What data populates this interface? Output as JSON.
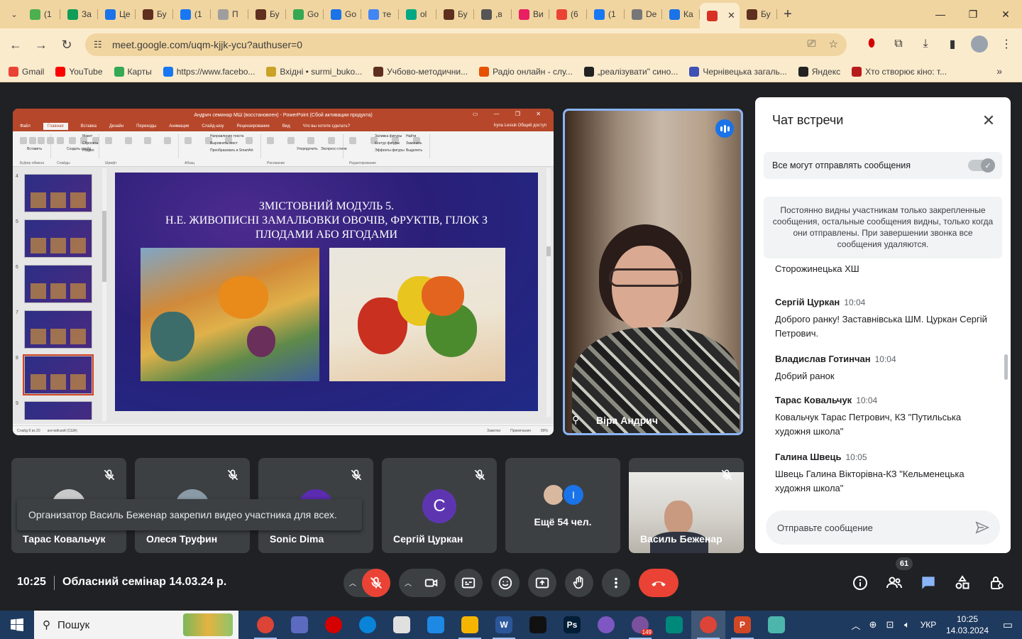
{
  "browser": {
    "tabs": [
      {
        "label": "(1",
        "color": "#4caf50"
      },
      {
        "label": "За",
        "color": "#0f9d58"
      },
      {
        "label": "Це",
        "color": "#1a73e8"
      },
      {
        "label": "Бу",
        "color": "#5f2f1f"
      },
      {
        "label": "(1",
        "color": "#1877f2"
      },
      {
        "label": "П",
        "color": "#9e9e9e"
      },
      {
        "label": "Бу",
        "color": "#5f2f1f"
      },
      {
        "label": "Go",
        "color": "#34a853"
      },
      {
        "label": "Go",
        "color": "#1a73e8"
      },
      {
        "label": "те",
        "color": "#4285f4"
      },
      {
        "label": "ol",
        "color": "#00a884"
      },
      {
        "label": "Бу",
        "color": "#5f2f1f"
      },
      {
        "label": ",в",
        "color": "#555555"
      },
      {
        "label": "Ви",
        "color": "#e91e63"
      },
      {
        "label": "(6",
        "color": "#ea4335"
      },
      {
        "label": "(1",
        "color": "#1877f2"
      },
      {
        "label": "De",
        "color": "#777777"
      },
      {
        "label": "Ка",
        "color": "#1a73e8"
      },
      {
        "label": "",
        "color": "#d93025"
      },
      {
        "label": "Бу",
        "color": "#5f2f1f"
      }
    ],
    "active_tab_index": 18,
    "url": "meet.google.com/uqm-kjjk-ycu?authuser=0",
    "bookmarks": [
      {
        "label": "Gmail",
        "color": "#ea4335"
      },
      {
        "label": "YouTube",
        "color": "#ff0000"
      },
      {
        "label": "Карты",
        "color": "#34a853"
      },
      {
        "label": "https://www.facebo...",
        "color": "#1877f2"
      },
      {
        "label": "Вхідні • surmi_buko...",
        "color": "#c9a227"
      },
      {
        "label": "Учбово-методични...",
        "color": "#5f2f1f"
      },
      {
        "label": "Радіо онлайн - слу...",
        "color": "#e65100"
      },
      {
        "label": "„реалізувати\" сино...",
        "color": "#222222"
      },
      {
        "label": "Чернівецька загаль...",
        "color": "#3f51b5"
      },
      {
        "label": "Яндекс",
        "color": "#222222"
      },
      {
        "label": "Хто створює кіно: т...",
        "color": "#b71c1c"
      }
    ]
  },
  "presentation": {
    "window_title": "Андрич семинар МШ (восстановлен) - PowerPoint (Сбой активации продукта)",
    "menu": [
      "Файл",
      "Главная",
      "Вставка",
      "Дизайн",
      "Переходы",
      "Анимация",
      "Слайд-шоу",
      "Рецензирование",
      "Вид",
      "Что вы хотите сделать?"
    ],
    "user": "Iryna Lesiuk   Общий доступ",
    "ribbon_groups": [
      "Буфер обмена",
      "Слайды",
      "Шрифт",
      "Абзац",
      "Рисование",
      "Редактирование"
    ],
    "ribbon_items": [
      "Вставить",
      "Создать слайд",
      "Макет",
      "Сбросить",
      "Раздел",
      "Направление текста",
      "Выровнять текст",
      "Преобразовать в SmartArt",
      "Упорядочить",
      "Экспресс-стили",
      "Заливка фигуры",
      "Контур фигуры",
      "Эффекты фигуры",
      "Найти",
      "Заменить",
      "Выделить"
    ],
    "thumbnail_numbers": [
      "4",
      "5",
      "6",
      "7",
      "8",
      "9"
    ],
    "selected_thumbnail": "8",
    "slide_title_lines": [
      "ЗМІСТОВНИЙ МОДУЛЬ 5.",
      "Н.Е. ЖИВОПИСНІ ЗАМАЛЬОВКИ ОВОЧІВ, ФРУКТІВ, ГІЛОК З",
      "ПЛОДАМИ АБО ЯГОДАМИ"
    ],
    "status_left": "Слайд 8 из 20",
    "status_lang": "английский (США)",
    "status_notes": "Заметки",
    "status_comments": "Примечания",
    "zoom": "89%"
  },
  "speaker": {
    "name": "Віра Андрич"
  },
  "participants": [
    {
      "name": "Тарас Ковальчук",
      "avatar_color": "#c9c9c9",
      "initial": ""
    },
    {
      "name": "Олеся Труфин",
      "avatar_color": "#8a9aa6",
      "initial": ""
    },
    {
      "name": "Sonic Dima",
      "avatar_color": "#5b2bb0",
      "initial": ""
    },
    {
      "name": "Сергій Цуркан",
      "avatar_color": "#5e35b1",
      "initial": "С"
    }
  ],
  "more_tile": {
    "label": "Ещё 54 чел.",
    "avatar_initial": "I",
    "avatar_color": "#1a73e8"
  },
  "video_participant": {
    "name": "Василь Беженар"
  },
  "toast": "Организатор Василь Беженар закрепил видео участника для всех.",
  "chat": {
    "title": "Чат встречи",
    "toggle_label": "Все могут отправлять сообщения",
    "notice": "Постоянно видны участникам только закрепленные сообщения, остальные сообщения видны, только когда они отправлены. При завершении звонка все сообщения удаляются.",
    "cut_message": "Сторожинецька ХШ",
    "messages": [
      {
        "author": "Сергій Цуркан",
        "time": "10:04",
        "text": "Доброго ранку! Заставнівська ШМ. Цуркан Сергій Петрович."
      },
      {
        "author": "Владислав Готинчан",
        "time": "10:04",
        "text": "Добрий ранок"
      },
      {
        "author": "Тарас Ковальчук",
        "time": "10:04",
        "text": "Ковальчук Тарас Петрович, КЗ \"Путильська художня школа\""
      },
      {
        "author": "Галина Швець",
        "time": "10:05",
        "text": "Швець Галина Вікторівна-КЗ \"Кельменецька художня школа\""
      }
    ],
    "input_placeholder": "Отправьте сообщение"
  },
  "controls": {
    "time": "10:25",
    "meeting_title": "Обласний семінар 14.03.24 р.",
    "people_count": "61"
  },
  "taskbar": {
    "search_label": "Пошук",
    "apps": [
      {
        "name": "chrome",
        "color": "#db4437",
        "glyph": "",
        "open": true
      },
      {
        "name": "app-blue",
        "color": "#5c6bc0",
        "glyph": "",
        "open": false
      },
      {
        "name": "opera",
        "color": "#d50000",
        "glyph": "",
        "open": false
      },
      {
        "name": "edge",
        "color": "#0a84d8",
        "glyph": "",
        "open": false
      },
      {
        "name": "document",
        "color": "#e0e0e0",
        "glyph": "",
        "open": false
      },
      {
        "name": "screen",
        "color": "#1e88e5",
        "glyph": "",
        "open": false
      },
      {
        "name": "explorer",
        "color": "#f4b400",
        "glyph": "",
        "open": true
      },
      {
        "name": "word",
        "color": "#2b579a",
        "glyph": "W",
        "open": true
      },
      {
        "name": "app-green",
        "color": "#111111",
        "glyph": "",
        "open": false
      },
      {
        "name": "photoshop",
        "color": "#001e36",
        "glyph": "Ps",
        "open": false
      },
      {
        "name": "picasa",
        "color": "#7e57c2",
        "glyph": "",
        "open": false
      },
      {
        "name": "viber",
        "color": "#7b519d",
        "glyph": "",
        "open": true,
        "badge": "149"
      },
      {
        "name": "app-teal",
        "color": "#00897b",
        "glyph": "",
        "open": false
      },
      {
        "name": "chrome-meet",
        "color": "#db4437",
        "glyph": "",
        "open": true,
        "active": true
      },
      {
        "name": "powerpoint",
        "color": "#d24726",
        "glyph": "P",
        "open": true
      },
      {
        "name": "app-tool",
        "color": "#4db6ac",
        "glyph": "",
        "open": false
      }
    ],
    "lang": "УКР",
    "time": "10:25",
    "date": "14.03.2024"
  }
}
